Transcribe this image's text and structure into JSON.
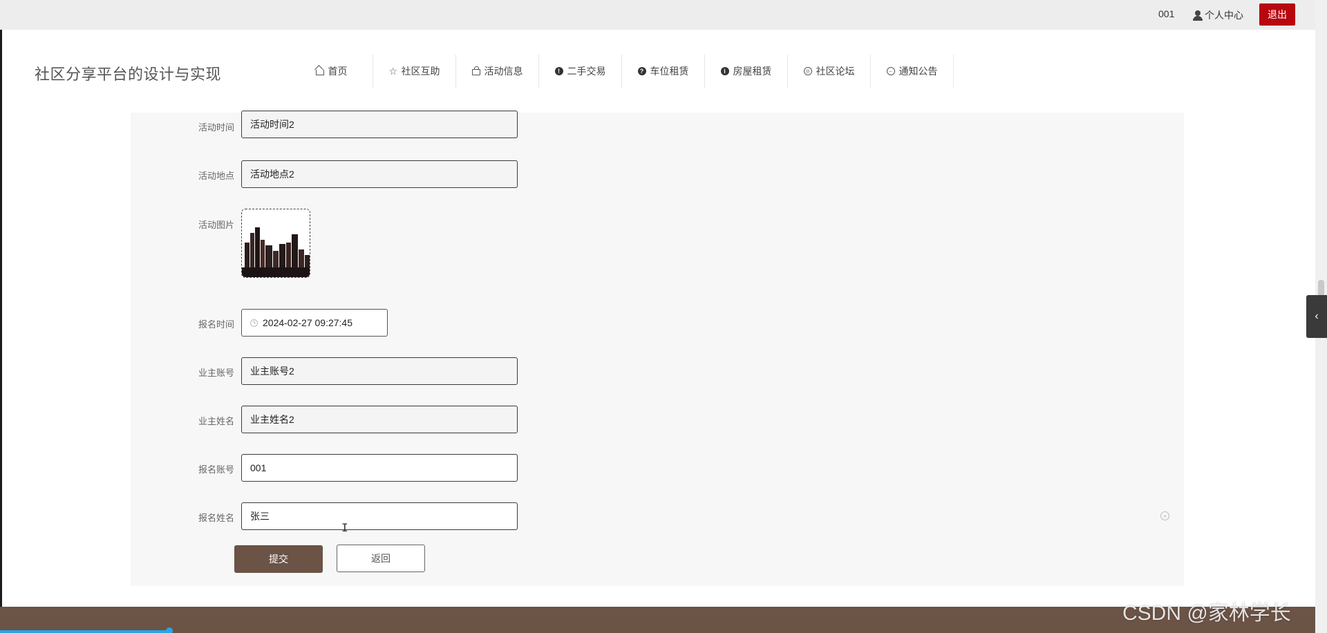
{
  "topbar": {
    "user_id": "001",
    "personal_center": "个人中心",
    "logout": "退出"
  },
  "header": {
    "site_title": "社区分享平台的设计与实现",
    "nav": [
      {
        "label": "首页",
        "icon": "home-icon"
      },
      {
        "label": "社区互助",
        "icon": "star-icon"
      },
      {
        "label": "活动信息",
        "icon": "bag-icon"
      },
      {
        "label": "二手交易",
        "icon": "exclamation-icon"
      },
      {
        "label": "车位租赁",
        "icon": "question-icon"
      },
      {
        "label": "房屋租赁",
        "icon": "info-icon"
      },
      {
        "label": "社区论坛",
        "icon": "globe-icon"
      },
      {
        "label": "通知公告",
        "icon": "minus-circle-icon"
      }
    ]
  },
  "form": {
    "fields": {
      "activity_time": {
        "label": "活动时间",
        "value": "活动时间2"
      },
      "activity_place": {
        "label": "活动地点",
        "value": "活动地点2"
      },
      "activity_image": {
        "label": "活动图片"
      },
      "signup_time": {
        "label": "报名时间",
        "value": "2024-02-27 09:27:45"
      },
      "owner_account": {
        "label": "业主账号",
        "value": "业主账号2"
      },
      "owner_name": {
        "label": "业主姓名",
        "value": "业主姓名2"
      },
      "signup_account": {
        "label": "报名账号",
        "value": "001"
      },
      "signup_name": {
        "label": "报名姓名",
        "value": "张三"
      }
    },
    "submit": "提交",
    "back": "返回"
  },
  "watermark": "CSDN @家林学长",
  "colors": {
    "brand": "#6b5346",
    "logout": "#b8070f",
    "progress": "#2aa5e8"
  }
}
